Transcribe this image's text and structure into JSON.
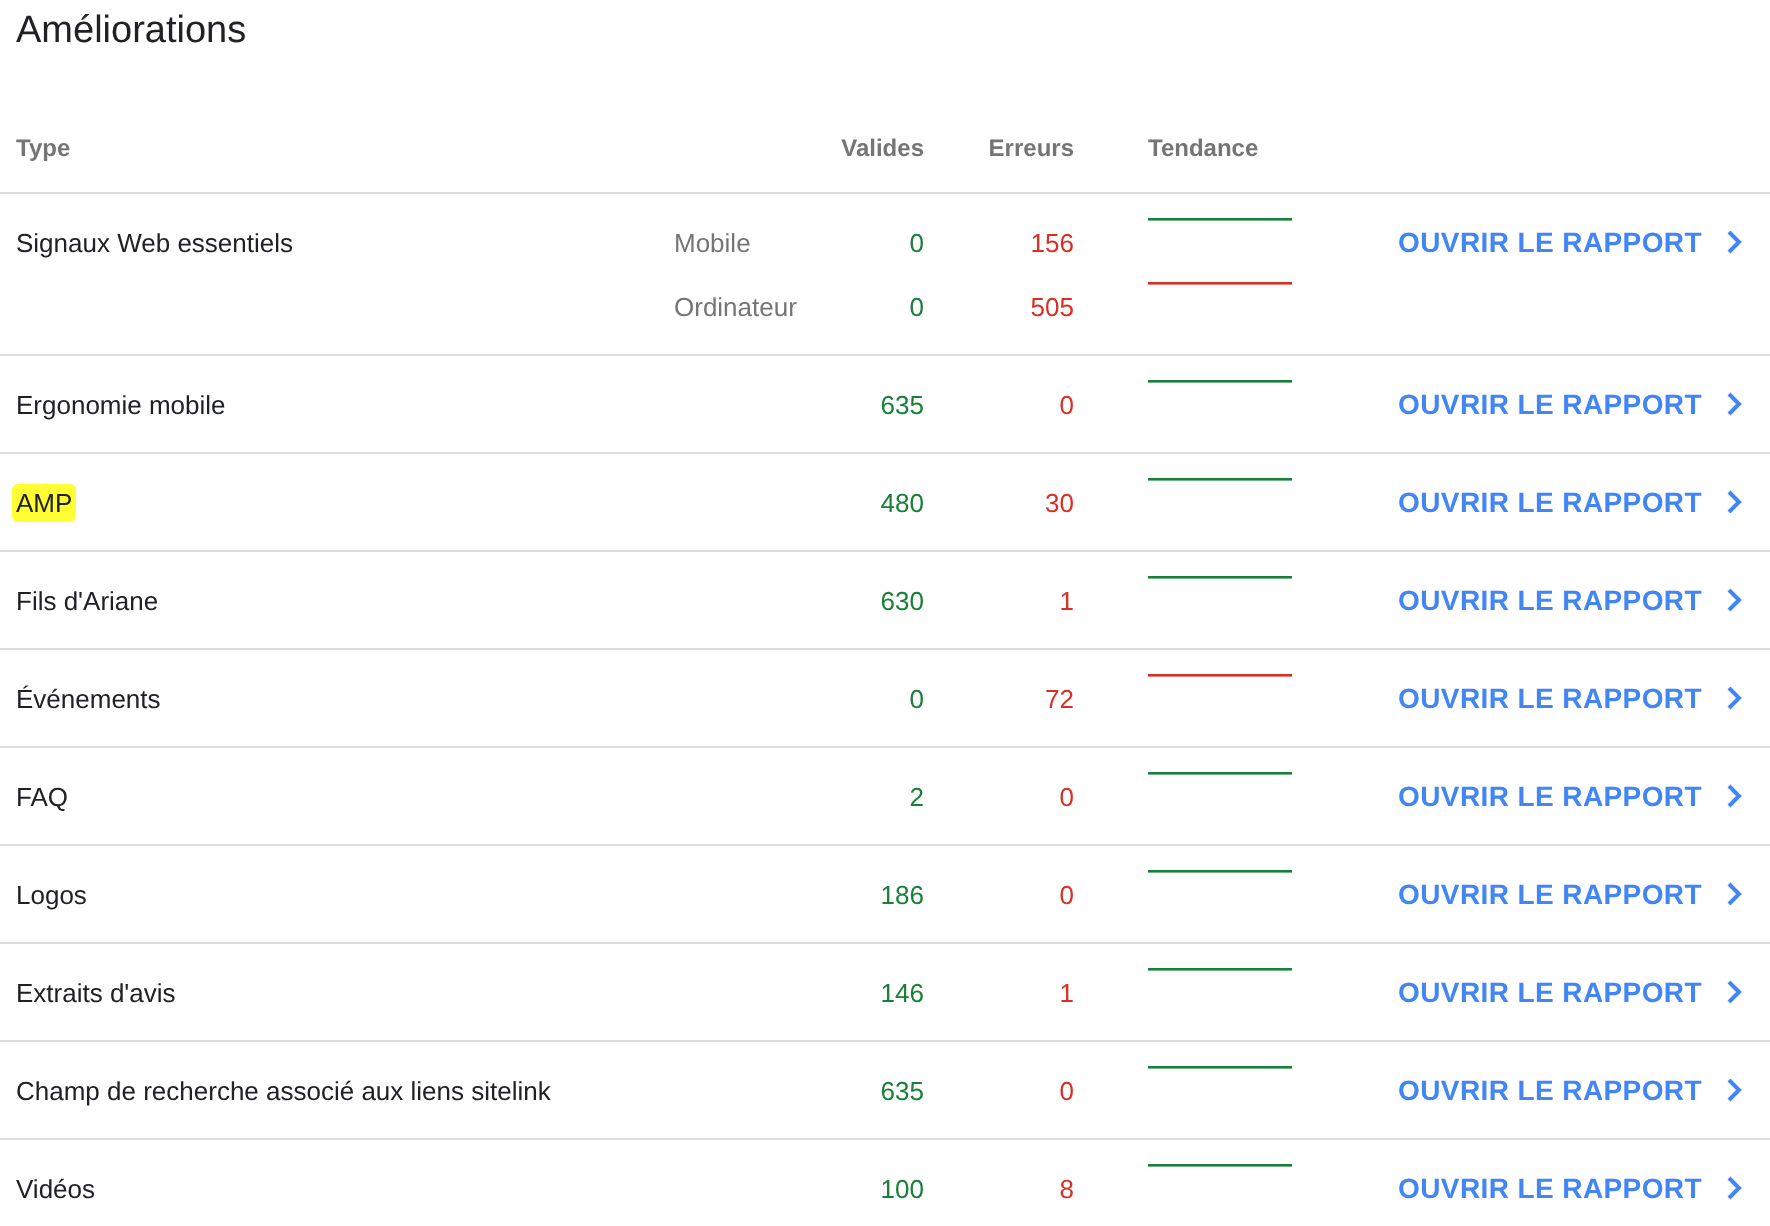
{
  "title": "Améliorations",
  "columns": [
    "Type",
    "Valides",
    "Erreurs",
    "Tendance"
  ],
  "rows": [
    {
      "type": "Signaux Web essentiels",
      "highlighted": false,
      "button": "OUVRIR LE RAPPORT",
      "segments": [
        {
          "label": "Mobile",
          "valid": "0",
          "errors": "156",
          "color": "#188038"
        },
        {
          "label": "Ordinateur",
          "valid": "0",
          "errors": "505",
          "color": "#d93025"
        }
      ]
    },
    {
      "type": "Ergonomie mobile",
      "highlighted": false,
      "button": "OUVRIR LE RAPPORT",
      "segments": [
        {
          "valid": "635",
          "errors": "0",
          "color": "#188038"
        }
      ]
    },
    {
      "type": "AMP",
      "highlighted": true,
      "button": "OUVRIR LE RAPPORT",
      "segments": [
        {
          "valid": "480",
          "errors": "30",
          "color": "#188038"
        }
      ]
    },
    {
      "type": "Fils d'Ariane",
      "highlighted": false,
      "button": "OUVRIR LE RAPPORT",
      "segments": [
        {
          "valid": "630",
          "errors": "1",
          "color": "#188038"
        }
      ]
    },
    {
      "type": "Événements",
      "highlighted": false,
      "button": "OUVRIR LE RAPPORT",
      "segments": [
        {
          "valid": "0",
          "errors": "72",
          "color": "#d93025"
        }
      ]
    },
    {
      "type": "FAQ",
      "highlighted": false,
      "button": "OUVRIR LE RAPPORT",
      "segments": [
        {
          "valid": "2",
          "errors": "0",
          "color": "#188038"
        }
      ]
    },
    {
      "type": "Logos",
      "highlighted": false,
      "button": "OUVRIR LE RAPPORT",
      "segments": [
        {
          "valid": "186",
          "errors": "0",
          "color": "#188038"
        }
      ]
    },
    {
      "type": "Extraits d'avis",
      "highlighted": false,
      "button": "OUVRIR LE RAPPORT",
      "segments": [
        {
          "valid": "146",
          "errors": "1",
          "color": "#188038"
        }
      ]
    },
    {
      "type": "Champ de recherche associé aux liens sitelink",
      "highlighted": false,
      "button": "OUVRIR LE RAPPORT",
      "segments": [
        {
          "valid": "635",
          "errors": "0",
          "color": "#188038"
        }
      ]
    },
    {
      "type": "Vidéos",
      "highlighted": false,
      "button": "OUVRIR LE RAPPORT",
      "segments": [
        {
          "valid": "100",
          "errors": "8",
          "color": "#188038"
        }
      ]
    }
  ]
}
